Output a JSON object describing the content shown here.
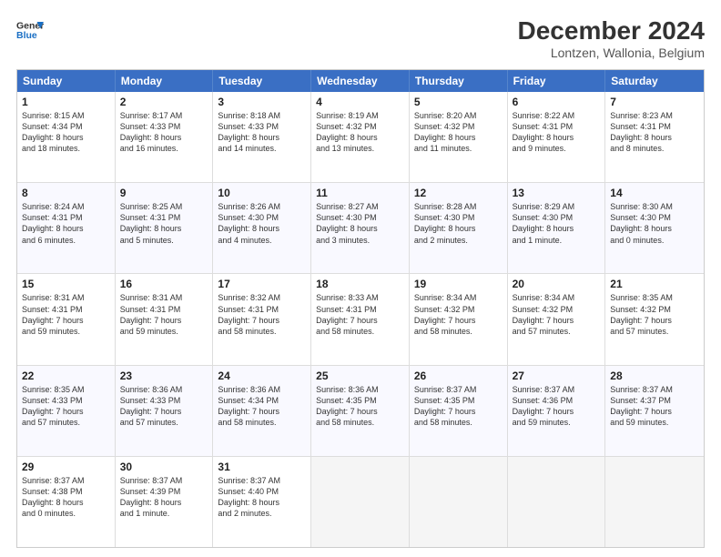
{
  "header": {
    "logo_line1": "General",
    "logo_line2": "Blue",
    "title": "December 2024",
    "subtitle": "Lontzen, Wallonia, Belgium"
  },
  "weekdays": [
    "Sunday",
    "Monday",
    "Tuesday",
    "Wednesday",
    "Thursday",
    "Friday",
    "Saturday"
  ],
  "weeks": [
    [
      {
        "day": "1",
        "lines": [
          "Sunrise: 8:15 AM",
          "Sunset: 4:34 PM",
          "Daylight: 8 hours",
          "and 18 minutes."
        ]
      },
      {
        "day": "2",
        "lines": [
          "Sunrise: 8:17 AM",
          "Sunset: 4:33 PM",
          "Daylight: 8 hours",
          "and 16 minutes."
        ]
      },
      {
        "day": "3",
        "lines": [
          "Sunrise: 8:18 AM",
          "Sunset: 4:33 PM",
          "Daylight: 8 hours",
          "and 14 minutes."
        ]
      },
      {
        "day": "4",
        "lines": [
          "Sunrise: 8:19 AM",
          "Sunset: 4:32 PM",
          "Daylight: 8 hours",
          "and 13 minutes."
        ]
      },
      {
        "day": "5",
        "lines": [
          "Sunrise: 8:20 AM",
          "Sunset: 4:32 PM",
          "Daylight: 8 hours",
          "and 11 minutes."
        ]
      },
      {
        "day": "6",
        "lines": [
          "Sunrise: 8:22 AM",
          "Sunset: 4:31 PM",
          "Daylight: 8 hours",
          "and 9 minutes."
        ]
      },
      {
        "day": "7",
        "lines": [
          "Sunrise: 8:23 AM",
          "Sunset: 4:31 PM",
          "Daylight: 8 hours",
          "and 8 minutes."
        ]
      }
    ],
    [
      {
        "day": "8",
        "lines": [
          "Sunrise: 8:24 AM",
          "Sunset: 4:31 PM",
          "Daylight: 8 hours",
          "and 6 minutes."
        ]
      },
      {
        "day": "9",
        "lines": [
          "Sunrise: 8:25 AM",
          "Sunset: 4:31 PM",
          "Daylight: 8 hours",
          "and 5 minutes."
        ]
      },
      {
        "day": "10",
        "lines": [
          "Sunrise: 8:26 AM",
          "Sunset: 4:30 PM",
          "Daylight: 8 hours",
          "and 4 minutes."
        ]
      },
      {
        "day": "11",
        "lines": [
          "Sunrise: 8:27 AM",
          "Sunset: 4:30 PM",
          "Daylight: 8 hours",
          "and 3 minutes."
        ]
      },
      {
        "day": "12",
        "lines": [
          "Sunrise: 8:28 AM",
          "Sunset: 4:30 PM",
          "Daylight: 8 hours",
          "and 2 minutes."
        ]
      },
      {
        "day": "13",
        "lines": [
          "Sunrise: 8:29 AM",
          "Sunset: 4:30 PM",
          "Daylight: 8 hours",
          "and 1 minute."
        ]
      },
      {
        "day": "14",
        "lines": [
          "Sunrise: 8:30 AM",
          "Sunset: 4:30 PM",
          "Daylight: 8 hours",
          "and 0 minutes."
        ]
      }
    ],
    [
      {
        "day": "15",
        "lines": [
          "Sunrise: 8:31 AM",
          "Sunset: 4:31 PM",
          "Daylight: 7 hours",
          "and 59 minutes."
        ]
      },
      {
        "day": "16",
        "lines": [
          "Sunrise: 8:31 AM",
          "Sunset: 4:31 PM",
          "Daylight: 7 hours",
          "and 59 minutes."
        ]
      },
      {
        "day": "17",
        "lines": [
          "Sunrise: 8:32 AM",
          "Sunset: 4:31 PM",
          "Daylight: 7 hours",
          "and 58 minutes."
        ]
      },
      {
        "day": "18",
        "lines": [
          "Sunrise: 8:33 AM",
          "Sunset: 4:31 PM",
          "Daylight: 7 hours",
          "and 58 minutes."
        ]
      },
      {
        "day": "19",
        "lines": [
          "Sunrise: 8:34 AM",
          "Sunset: 4:32 PM",
          "Daylight: 7 hours",
          "and 58 minutes."
        ]
      },
      {
        "day": "20",
        "lines": [
          "Sunrise: 8:34 AM",
          "Sunset: 4:32 PM",
          "Daylight: 7 hours",
          "and 57 minutes."
        ]
      },
      {
        "day": "21",
        "lines": [
          "Sunrise: 8:35 AM",
          "Sunset: 4:32 PM",
          "Daylight: 7 hours",
          "and 57 minutes."
        ]
      }
    ],
    [
      {
        "day": "22",
        "lines": [
          "Sunrise: 8:35 AM",
          "Sunset: 4:33 PM",
          "Daylight: 7 hours",
          "and 57 minutes."
        ]
      },
      {
        "day": "23",
        "lines": [
          "Sunrise: 8:36 AM",
          "Sunset: 4:33 PM",
          "Daylight: 7 hours",
          "and 57 minutes."
        ]
      },
      {
        "day": "24",
        "lines": [
          "Sunrise: 8:36 AM",
          "Sunset: 4:34 PM",
          "Daylight: 7 hours",
          "and 58 minutes."
        ]
      },
      {
        "day": "25",
        "lines": [
          "Sunrise: 8:36 AM",
          "Sunset: 4:35 PM",
          "Daylight: 7 hours",
          "and 58 minutes."
        ]
      },
      {
        "day": "26",
        "lines": [
          "Sunrise: 8:37 AM",
          "Sunset: 4:35 PM",
          "Daylight: 7 hours",
          "and 58 minutes."
        ]
      },
      {
        "day": "27",
        "lines": [
          "Sunrise: 8:37 AM",
          "Sunset: 4:36 PM",
          "Daylight: 7 hours",
          "and 59 minutes."
        ]
      },
      {
        "day": "28",
        "lines": [
          "Sunrise: 8:37 AM",
          "Sunset: 4:37 PM",
          "Daylight: 7 hours",
          "and 59 minutes."
        ]
      }
    ],
    [
      {
        "day": "29",
        "lines": [
          "Sunrise: 8:37 AM",
          "Sunset: 4:38 PM",
          "Daylight: 8 hours",
          "and 0 minutes."
        ]
      },
      {
        "day": "30",
        "lines": [
          "Sunrise: 8:37 AM",
          "Sunset: 4:39 PM",
          "Daylight: 8 hours",
          "and 1 minute."
        ]
      },
      {
        "day": "31",
        "lines": [
          "Sunrise: 8:37 AM",
          "Sunset: 4:40 PM",
          "Daylight: 8 hours",
          "and 2 minutes."
        ]
      },
      null,
      null,
      null,
      null
    ]
  ]
}
